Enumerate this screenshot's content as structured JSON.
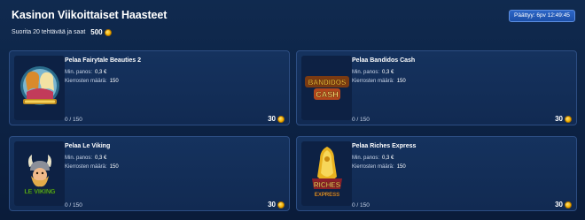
{
  "header": {
    "title": "Kasinon Viikoittaiset Haasteet",
    "subtitle": "Suorita 20 tehtävää ja saat",
    "reward_total": "500"
  },
  "timer": {
    "text": "Päättyy: 6pv 12:49:45"
  },
  "labels": {
    "min_bet": "Min. panos:",
    "rounds": "Kierrosten määrä:"
  },
  "colors": {
    "background": "#0c2244",
    "card": "#15325e",
    "accent": "#2d66c7",
    "coin": "#f5b301"
  },
  "challenges": [
    {
      "title": "Pelaa Fairytale Beauties 2",
      "min_bet": "0,3 €",
      "rounds": "150",
      "progress": "0 / 150",
      "reward": "30",
      "thumbnail_icon": "fairytale-beauties-logo"
    },
    {
      "title": "Pelaa Bandidos Cash",
      "min_bet": "0,3 €",
      "rounds": "150",
      "progress": "0 / 150",
      "reward": "30",
      "thumbnail_icon": "bandidos-cash-logo",
      "thumb_text": [
        "BANDIDOS",
        "CASH"
      ]
    },
    {
      "title": "Pelaa Le Viking",
      "min_bet": "0,3 €",
      "rounds": "150",
      "progress": "0 / 150",
      "reward": "30",
      "thumbnail_icon": "le-viking-logo",
      "thumb_text": [
        "LE VIKING"
      ]
    },
    {
      "title": "Pelaa Riches Express",
      "min_bet": "0,3 €",
      "rounds": "150",
      "progress": "0 / 150",
      "reward": "30",
      "thumbnail_icon": "riches-express-logo",
      "thumb_text": [
        "RICHES",
        "EXPRESS"
      ]
    }
  ]
}
